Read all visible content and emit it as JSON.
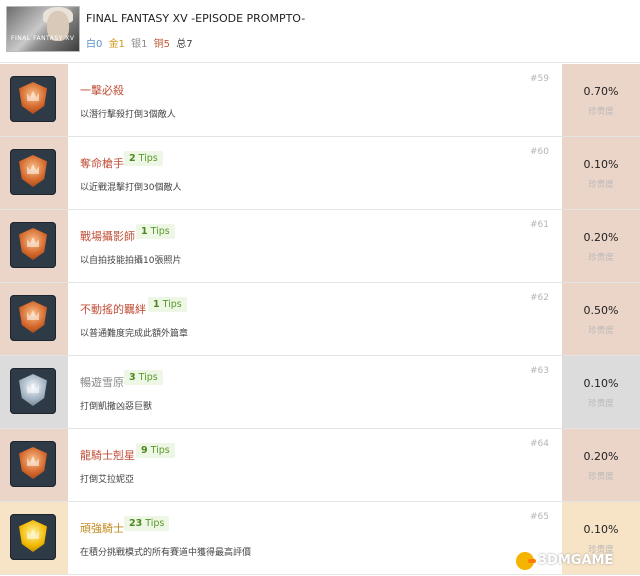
{
  "header": {
    "title": "FINAL FANTASY XV -EPISODE PROMPTO-",
    "cover_text": "FINAL FANTASY XV",
    "counts": [
      {
        "label": "白0",
        "color": "#5b8fc9"
      },
      {
        "label": "金1",
        "color": "#d19a1a"
      },
      {
        "label": "银1",
        "color": "#8a8a8a"
      },
      {
        "label": "铜5",
        "color": "#c05a36"
      },
      {
        "label": "总7",
        "color": "#444444"
      }
    ]
  },
  "trophies": [
    {
      "tier": "bronze",
      "name": "一擊必殺",
      "tips_count": "",
      "tips_label": "",
      "desc": "以潛行擊殺打倒3個敵人",
      "number": "#59",
      "percent": "0.70%",
      "rarity": "珍贵度"
    },
    {
      "tier": "bronze",
      "name": "奪命槍手",
      "tips_count": "2",
      "tips_label": "Tips",
      "desc": "以近戰混擊打倒30個敵人",
      "number": "#60",
      "percent": "0.10%",
      "rarity": "珍贵度"
    },
    {
      "tier": "bronze",
      "name": "戰場攝影師",
      "tips_count": "1",
      "tips_label": "Tips",
      "desc": "以自拍技能拍攝10張照片",
      "number": "#61",
      "percent": "0.20%",
      "rarity": "珍贵度"
    },
    {
      "tier": "bronze",
      "name": "不動搖的羈絆",
      "tips_count": "1",
      "tips_label": "Tips",
      "desc": "以普通難度完成此額外篇章",
      "number": "#62",
      "percent": "0.50%",
      "rarity": "珍贵度"
    },
    {
      "tier": "silver",
      "name": "暢遊雪原",
      "tips_count": "3",
      "tips_label": "Tips",
      "desc": "打倒凱撒凶惡巨獸",
      "number": "#63",
      "percent": "0.10%",
      "rarity": "珍贵度"
    },
    {
      "tier": "bronze",
      "name": "龍騎士剋星",
      "tips_count": "9",
      "tips_label": "Tips",
      "desc": "打倒艾拉妮亞",
      "number": "#64",
      "percent": "0.20%",
      "rarity": "珍贵度"
    },
    {
      "tier": "gold",
      "name": "頑強騎士",
      "tips_count": "23",
      "tips_label": "Tips",
      "desc": "在積分挑戰模式的所有賽道中獲得最高評價",
      "number": "#65",
      "percent": "0.10%",
      "rarity": "珍贵度"
    }
  ],
  "watermark": "3DMGAME"
}
